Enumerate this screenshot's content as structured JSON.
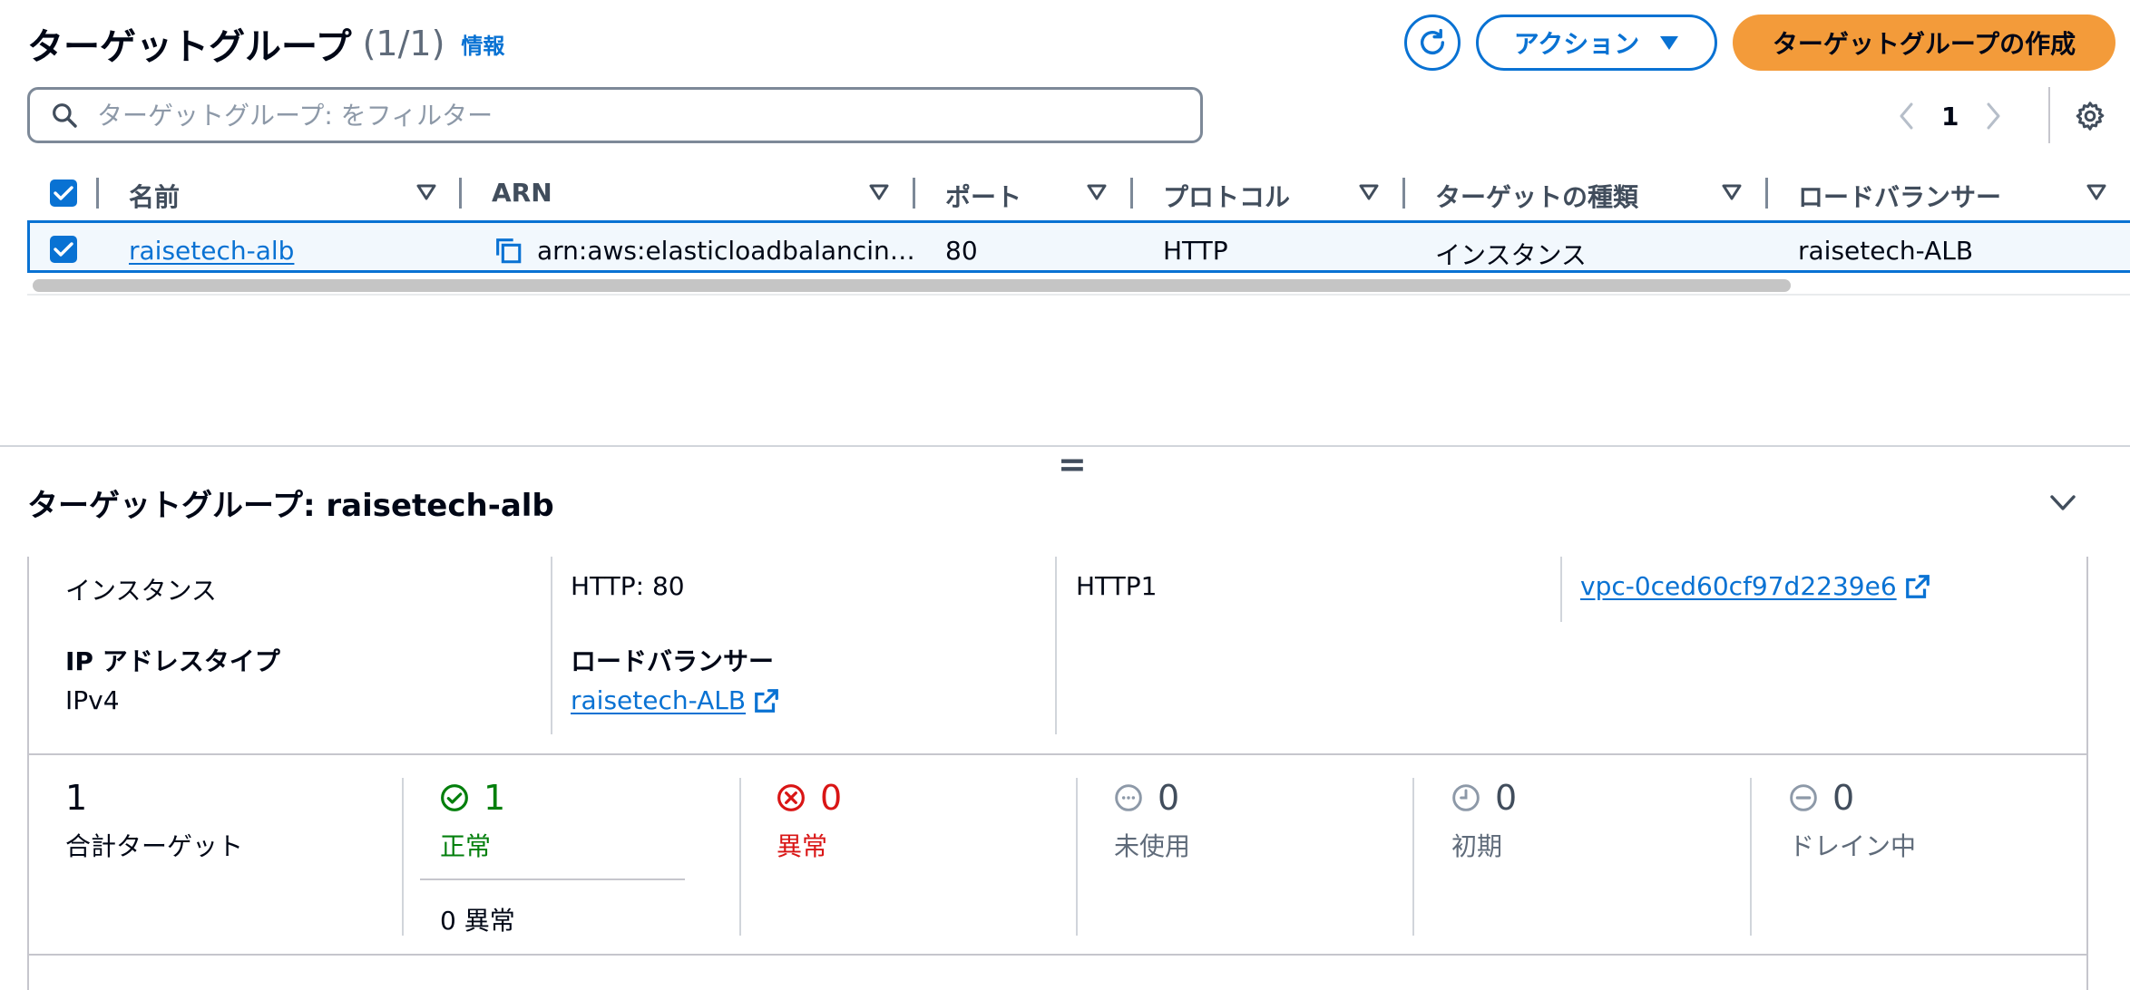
{
  "header": {
    "title": "ターゲットグループ",
    "count": "(1/1)",
    "info_link": "情報",
    "actions_label": "アクション",
    "create_label": "ターゲットグループの作成",
    "refresh_icon": "refresh-icon",
    "settings_icon": "gear-icon"
  },
  "filter": {
    "placeholder": "ターゲットグループ: をフィルター"
  },
  "pagination": {
    "current_page": "1"
  },
  "table": {
    "columns": [
      "名前",
      "ARN",
      "ポート",
      "プロトコル",
      "ターゲットの種類",
      "ロードバランサー"
    ],
    "rows": [
      {
        "name": "raisetech-alb",
        "arn": "arn:aws:elasticloadbalancin…",
        "port": "80",
        "protocol": "HTTP",
        "target_type": "インスタンス",
        "load_balancer": "raisetech-ALB"
      }
    ]
  },
  "resize_handle": "=",
  "detail": {
    "title": "ターゲットグループ: raisetech-alb",
    "target_type_value": "インスタンス",
    "protocol_port_value": "HTTP: 80",
    "protocol_version_value": "HTTP1",
    "vpc_value": "vpc-0ced60cf97d2239e6",
    "ip_type_label": "IP アドレスタイプ",
    "ip_type_value": "IPv4",
    "lb_label": "ロードバランサー",
    "lb_value": "raisetech-ALB"
  },
  "stats": {
    "total": {
      "count": "1",
      "label": "合計ターゲット"
    },
    "healthy": {
      "count": "1",
      "label": "正常",
      "sub": "0 異常"
    },
    "unhealthy": {
      "count": "0",
      "label": "異常"
    },
    "unused": {
      "count": "0",
      "label": "未使用"
    },
    "initial": {
      "count": "0",
      "label": "初期"
    },
    "draining": {
      "count": "0",
      "label": "ドレイン中"
    }
  },
  "colors": {
    "accent": "#0972d3",
    "primary_button": "#f39b3a",
    "healthy": "#037f0c",
    "unhealthy": "#d91515",
    "neutral": "#8d99a8"
  }
}
